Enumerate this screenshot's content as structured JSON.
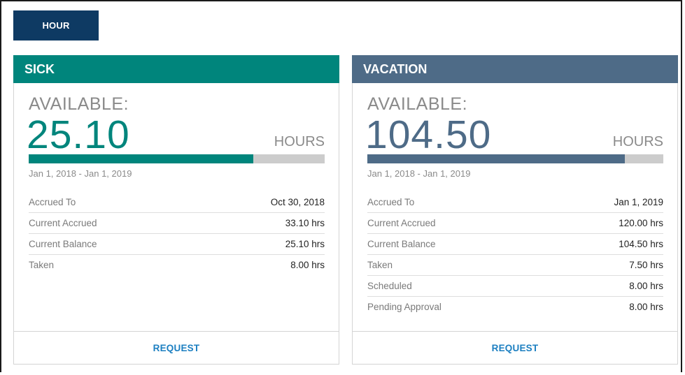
{
  "toolbar": {
    "hour_label": "HOUR"
  },
  "colors": {
    "sick_accent": "#00857c",
    "vacation_accent": "#4e6b87",
    "button_bg": "#0e3a63",
    "link": "#1c7fc1"
  },
  "cards": [
    {
      "title": "SICK",
      "available_label": "AVAILABLE:",
      "available_value": "25.10",
      "unit": "HOURS",
      "progress_percent": 76,
      "date_range": "Jan 1, 2018 - Jan 1, 2019",
      "rows": [
        {
          "label": "Accrued To",
          "value": "Oct 30, 2018"
        },
        {
          "label": "Current Accrued",
          "value": "33.10 hrs"
        },
        {
          "label": "Current Balance",
          "value": "25.10 hrs"
        },
        {
          "label": "Taken",
          "value": "8.00 hrs"
        }
      ],
      "request_label": "REQUEST"
    },
    {
      "title": "VACATION",
      "available_label": "AVAILABLE:",
      "available_value": "104.50",
      "unit": "HOURS",
      "progress_percent": 87,
      "date_range": "Jan 1, 2018 - Jan 1, 2019",
      "rows": [
        {
          "label": "Accrued To",
          "value": "Jan 1, 2019"
        },
        {
          "label": "Current Accrued",
          "value": "120.00 hrs"
        },
        {
          "label": "Current Balance",
          "value": "104.50 hrs"
        },
        {
          "label": "Taken",
          "value": "7.50 hrs"
        },
        {
          "label": "Scheduled",
          "value": "8.00 hrs"
        },
        {
          "label": "Pending Approval",
          "value": "8.00 hrs"
        }
      ],
      "request_label": "REQUEST"
    }
  ]
}
